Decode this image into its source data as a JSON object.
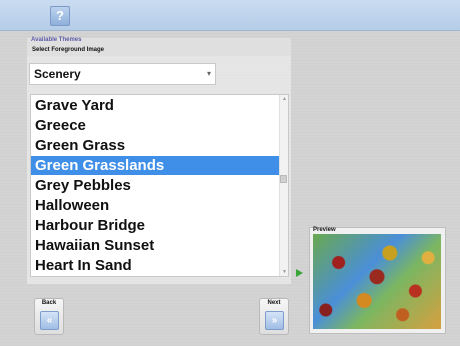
{
  "toolbar": {
    "help_icon": "?"
  },
  "themes": {
    "title": "Available Themes",
    "foreground_label": "Select Foreground Image",
    "category_value": "Scenery",
    "items": [
      "Grave Yard",
      "Greece",
      "Green Grass",
      "Green Grasslands",
      "Grey Pebbles",
      "Halloween",
      "Harbour Bridge",
      "Hawaiian Sunset",
      "Heart In Sand"
    ],
    "selected_item": "Green Grasslands"
  },
  "preview": {
    "label": "Preview"
  },
  "nav": {
    "back_label": "Back",
    "next_label": "Next",
    "back_icon": "«",
    "next_icon": "»"
  },
  "colors": {
    "selection": "#3f8ee8",
    "accent": "#5a5aa8",
    "arrow": "#3aa43a"
  }
}
